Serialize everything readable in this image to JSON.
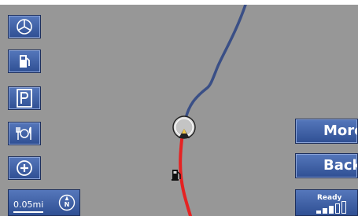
{
  "buttons": {
    "more_label": "More",
    "back_label": "Back"
  },
  "scale": {
    "label": "0.05mi"
  },
  "status": {
    "label": "Ready",
    "signal_level": 3,
    "signal_max": 5
  },
  "colors": {
    "map_background": "#979797",
    "route_ahead": "#3a4f86",
    "route_traveled": "#e52222",
    "button_blue": "#3f5fa5"
  },
  "icons": {
    "sidebar": [
      "mercedes-star-icon",
      "fuel-pump-icon",
      "parking-icon",
      "restaurant-icon",
      "plus-icon"
    ],
    "map": [
      "vehicle-position-icon",
      "fuel-pump-icon"
    ],
    "compass": "north-compass-icon"
  }
}
